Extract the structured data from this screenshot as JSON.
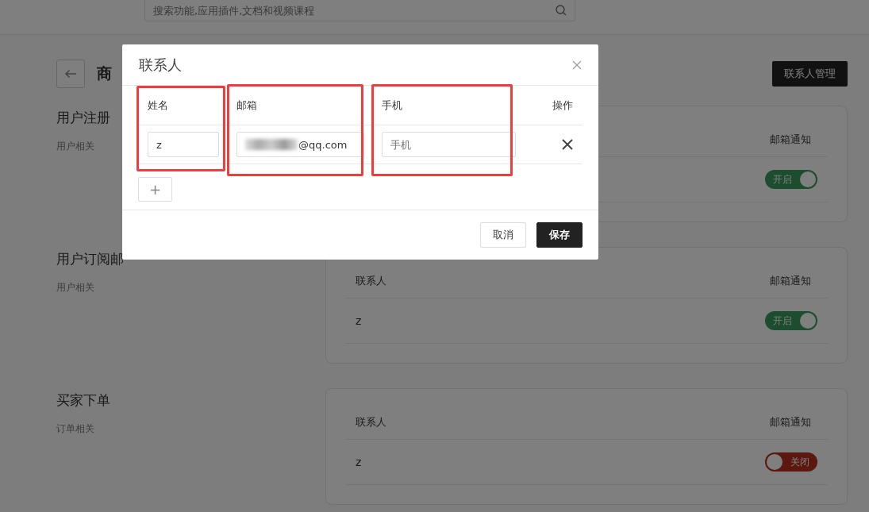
{
  "header": {
    "search_placeholder": "搜索功能,应用插件,文档和视频课程"
  },
  "page": {
    "title": "商",
    "manage_button": "联系人管理"
  },
  "sections": [
    {
      "title": "用户注册",
      "subtitle": "用户相关",
      "notify_header": "邮箱通知",
      "rows": [
        {
          "toggle": {
            "on": true,
            "label": "开启"
          }
        }
      ]
    },
    {
      "title": "用户订阅邮",
      "subtitle": "用户相关",
      "contact_header": "联系人",
      "notify_header": "邮箱通知",
      "rows": [
        {
          "name": "z",
          "toggle": {
            "on": true,
            "label": "开启"
          }
        }
      ]
    },
    {
      "title": "买家下单",
      "subtitle": "订单相关",
      "contact_header": "联系人",
      "notify_header": "邮箱通知",
      "rows": [
        {
          "name": "z",
          "toggle": {
            "on": false,
            "label": "关闭"
          }
        }
      ]
    }
  ],
  "modal": {
    "title": "联系人",
    "columns": [
      "姓名",
      "邮箱",
      "手机",
      "操作"
    ],
    "rows": [
      {
        "name": "z",
        "email": "@qq.com",
        "phone_placeholder": "手机"
      }
    ],
    "add_button": "+",
    "buttons": [
      {
        "label": "取消",
        "kind": "secondary"
      },
      {
        "label": "保存",
        "kind": "primary"
      }
    ]
  }
}
